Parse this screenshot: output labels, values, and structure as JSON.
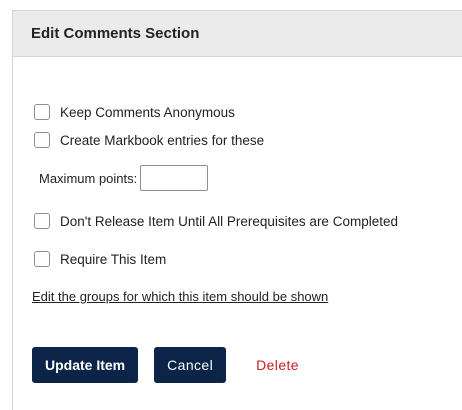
{
  "dialog": {
    "title": "Edit Comments Section"
  },
  "options": {
    "anonymous_label": "Keep Comments Anonymous",
    "markbook_label": "Create Markbook entries for these",
    "max_points_label": "Maximum points:",
    "max_points_value": "",
    "prerequisites_label": "Don't Release Item Until All Prerequisites are Completed",
    "require_label": "Require This Item"
  },
  "links": {
    "edit_groups": "Edit the groups for which this item should be shown"
  },
  "actions": {
    "update_label": "Update Item",
    "cancel_label": "Cancel",
    "delete_label": "Delete"
  },
  "colors": {
    "primary_button": "#0b2447",
    "delete_text": "#cc1f1f",
    "header_background": "#ebebeb"
  }
}
